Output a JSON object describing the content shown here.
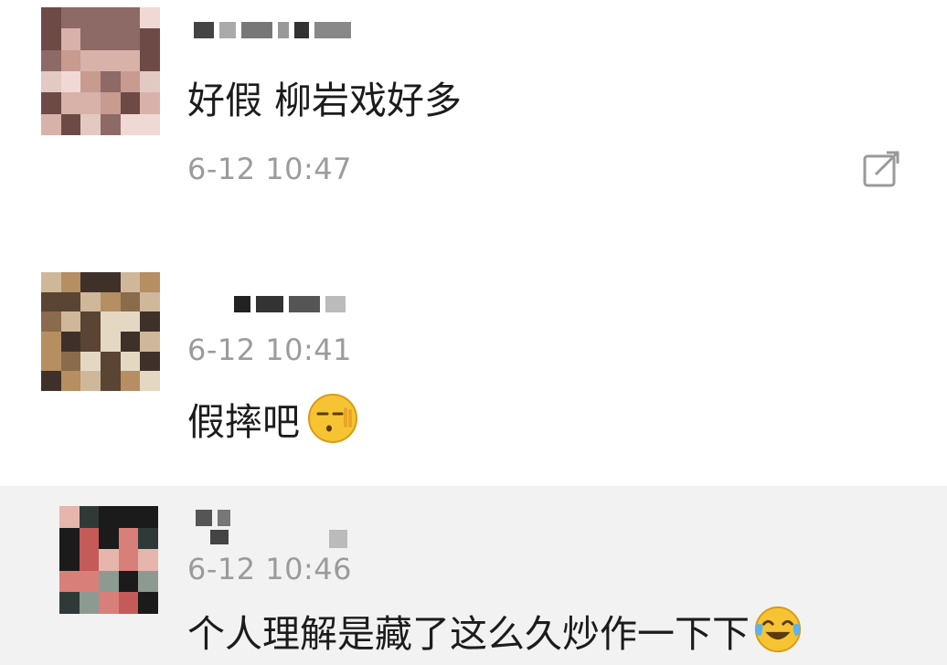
{
  "comments": [
    {
      "author": "",
      "text": "好假 柳岩戏好多",
      "time": "6-12 10:47",
      "avatar": "pixelated-avatar",
      "action": "share-icon",
      "palette": [
        "#e2c9c2",
        "#c79b90",
        "#8e6a66",
        "#d8b2a9",
        "#f0d9d4",
        "#6e4a46"
      ]
    },
    {
      "author": "",
      "time": "6-12 10:41",
      "text": "假摔吧",
      "emoji": "shh-emoji",
      "avatar": "pixelated-avatar",
      "palette": [
        "#cfb89a",
        "#b58e62",
        "#8a6b4c",
        "#5a4434",
        "#e5d8c2",
        "#3f3129"
      ]
    },
    {
      "author": "",
      "time": "6-12 10:46",
      "text": "个人理解是藏了这么久炒作一下下",
      "emoji": "laugh-cry-emoji",
      "avatar": "pixelated-avatar",
      "palette": [
        "#2f3a38",
        "#c45b59",
        "#e6b5ac",
        "#1b1b1b",
        "#d97f7a",
        "#8d9a91"
      ]
    }
  ]
}
